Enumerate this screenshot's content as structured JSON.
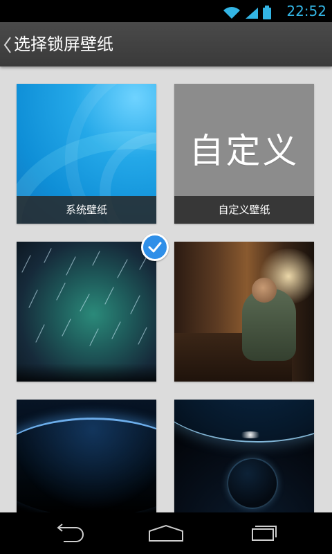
{
  "status_bar": {
    "time": "22:52",
    "icons": [
      "wifi-icon",
      "signal-icon",
      "battery-icon"
    ],
    "accent_color": "#33b5e5"
  },
  "action_bar": {
    "title": "选择锁屏壁纸",
    "back_icon": "chevron-left-icon"
  },
  "wallpapers": [
    {
      "caption": "系统壁纸",
      "selected": false
    },
    {
      "caption": "自定义壁纸",
      "big_text": "自定义",
      "selected": false
    },
    {
      "selected": true
    },
    {
      "selected": false
    },
    {
      "selected": false
    },
    {
      "selected": false
    }
  ],
  "navigation_bar": {
    "icons": [
      "back-icon",
      "home-icon",
      "recent-apps-icon"
    ]
  }
}
